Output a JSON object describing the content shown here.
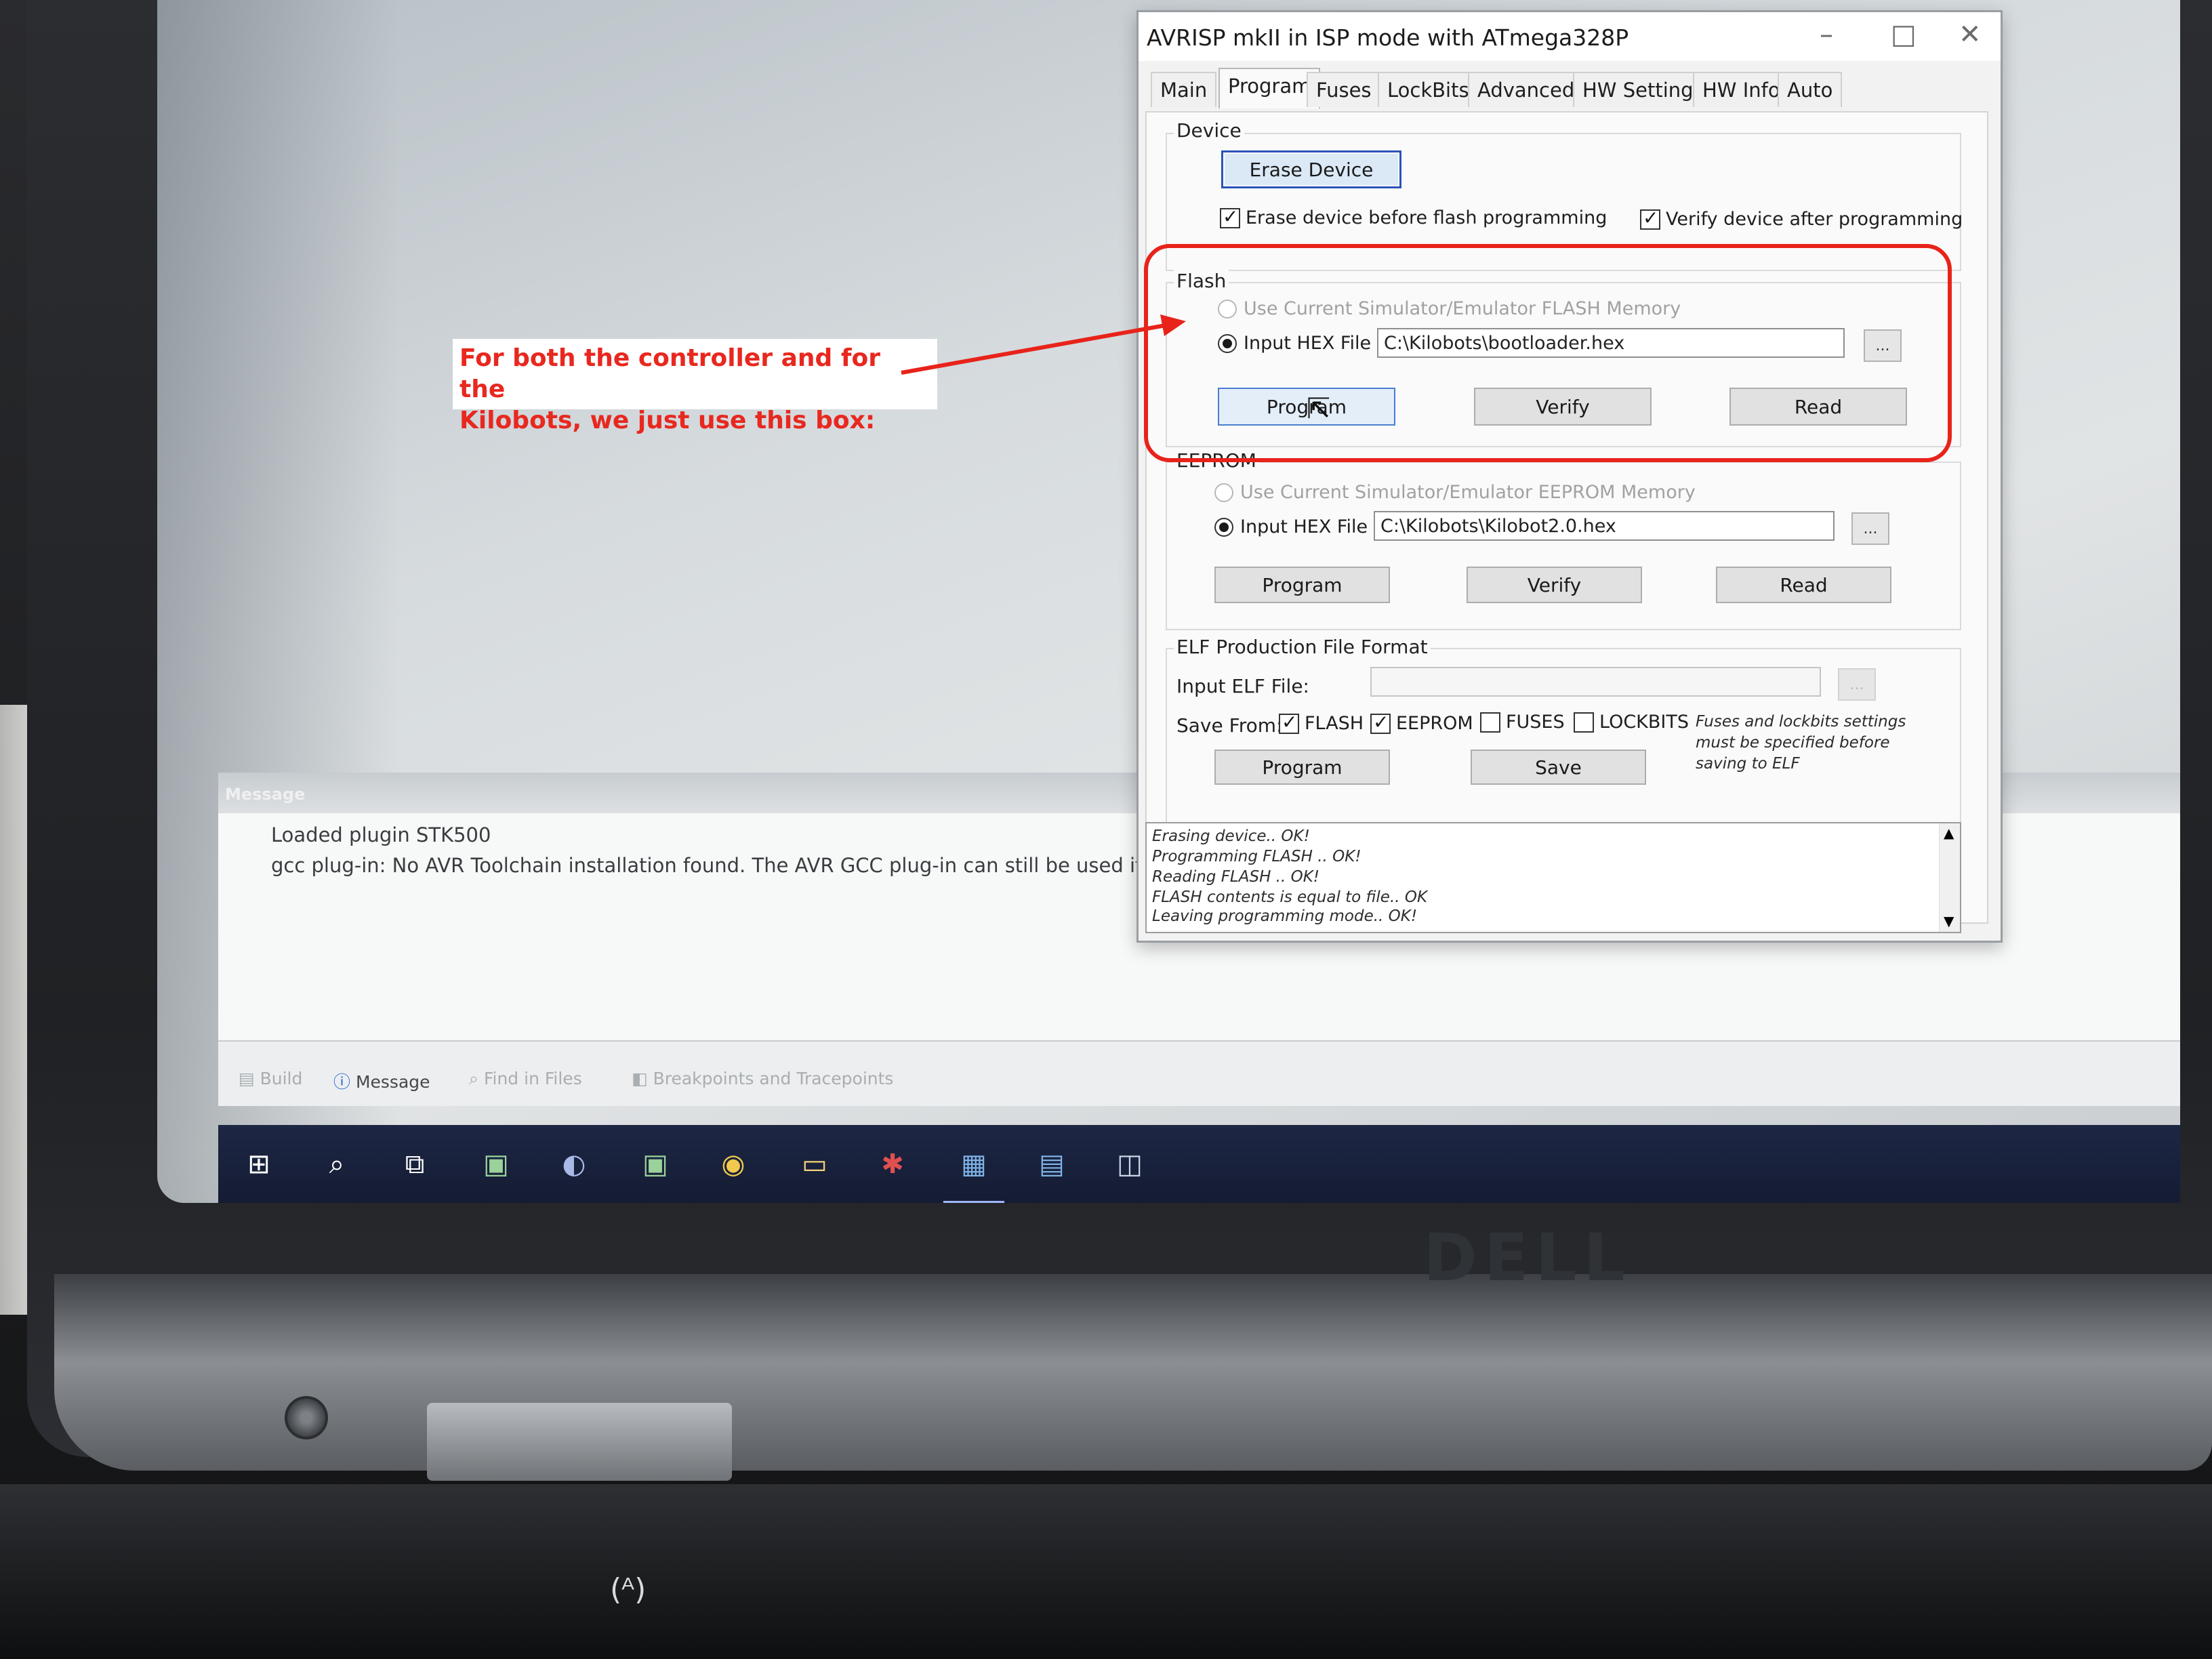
{
  "dialog": {
    "title": "AVRISP mkII in ISP mode with ATmega328P",
    "tabs": [
      "Main",
      "Program",
      "Fuses",
      "LockBits",
      "Advanced",
      "HW Settings",
      "HW Info",
      "Auto"
    ],
    "active_tab": "Program"
  },
  "device": {
    "label": "Device",
    "erase_button": "Erase Device",
    "erase_before_flash": "Erase device before flash programming",
    "verify_after": "Verify device after programming"
  },
  "flash": {
    "label": "Flash",
    "use_sim": "Use Current Simulator/Emulator FLASH Memory",
    "input_hex": "Input HEX File",
    "hex_path": "C:\\Kilobots\\bootloader.hex",
    "browse": "...",
    "program": "Program",
    "verify": "Verify",
    "read": "Read"
  },
  "eeprom": {
    "label": "EEPROM",
    "use_sim": "Use Current Simulator/Emulator EEPROM Memory",
    "input_hex": "Input HEX File",
    "hex_path": "C:\\Kilobots\\Kilobot2.0.hex",
    "browse": "...",
    "program": "Program",
    "verify": "Verify",
    "read": "Read"
  },
  "elf": {
    "label": "ELF Production File Format",
    "input_label": "Input ELF File:",
    "save_from": "Save From:",
    "opt_flash": "FLASH",
    "opt_eeprom": "EEPROM",
    "opt_fuses": "FUSES",
    "opt_lockbits": "LOCKBITS",
    "note_1": "Fuses and lockbits settings",
    "note_2": "must be specified before",
    "note_3": "saving to ELF",
    "program": "Program",
    "save": "Save"
  },
  "log": [
    "Erasing device.. OK!",
    "Programming FLASH ..     OK!",
    "Reading FLASH ..     OK!",
    "FLASH contents is equal to file.. OK",
    "Leaving programming mode.. OK!"
  ],
  "output": {
    "title": "Message",
    "line1": "Loaded plugin STK500",
    "line2": "gcc plug-in: No AVR Toolchain installation found. The AVR GCC plug-in can still be used if you set",
    "tabs": [
      "Build",
      "Message",
      "Find in Files",
      "Breakpoints and Tracepoints"
    ]
  },
  "annotation": {
    "line1": "For both the controller and for the",
    "line2": "Kilobots, we just use this box:",
    "color": "#e8231a"
  },
  "laptop": {
    "brand": "DELL"
  }
}
